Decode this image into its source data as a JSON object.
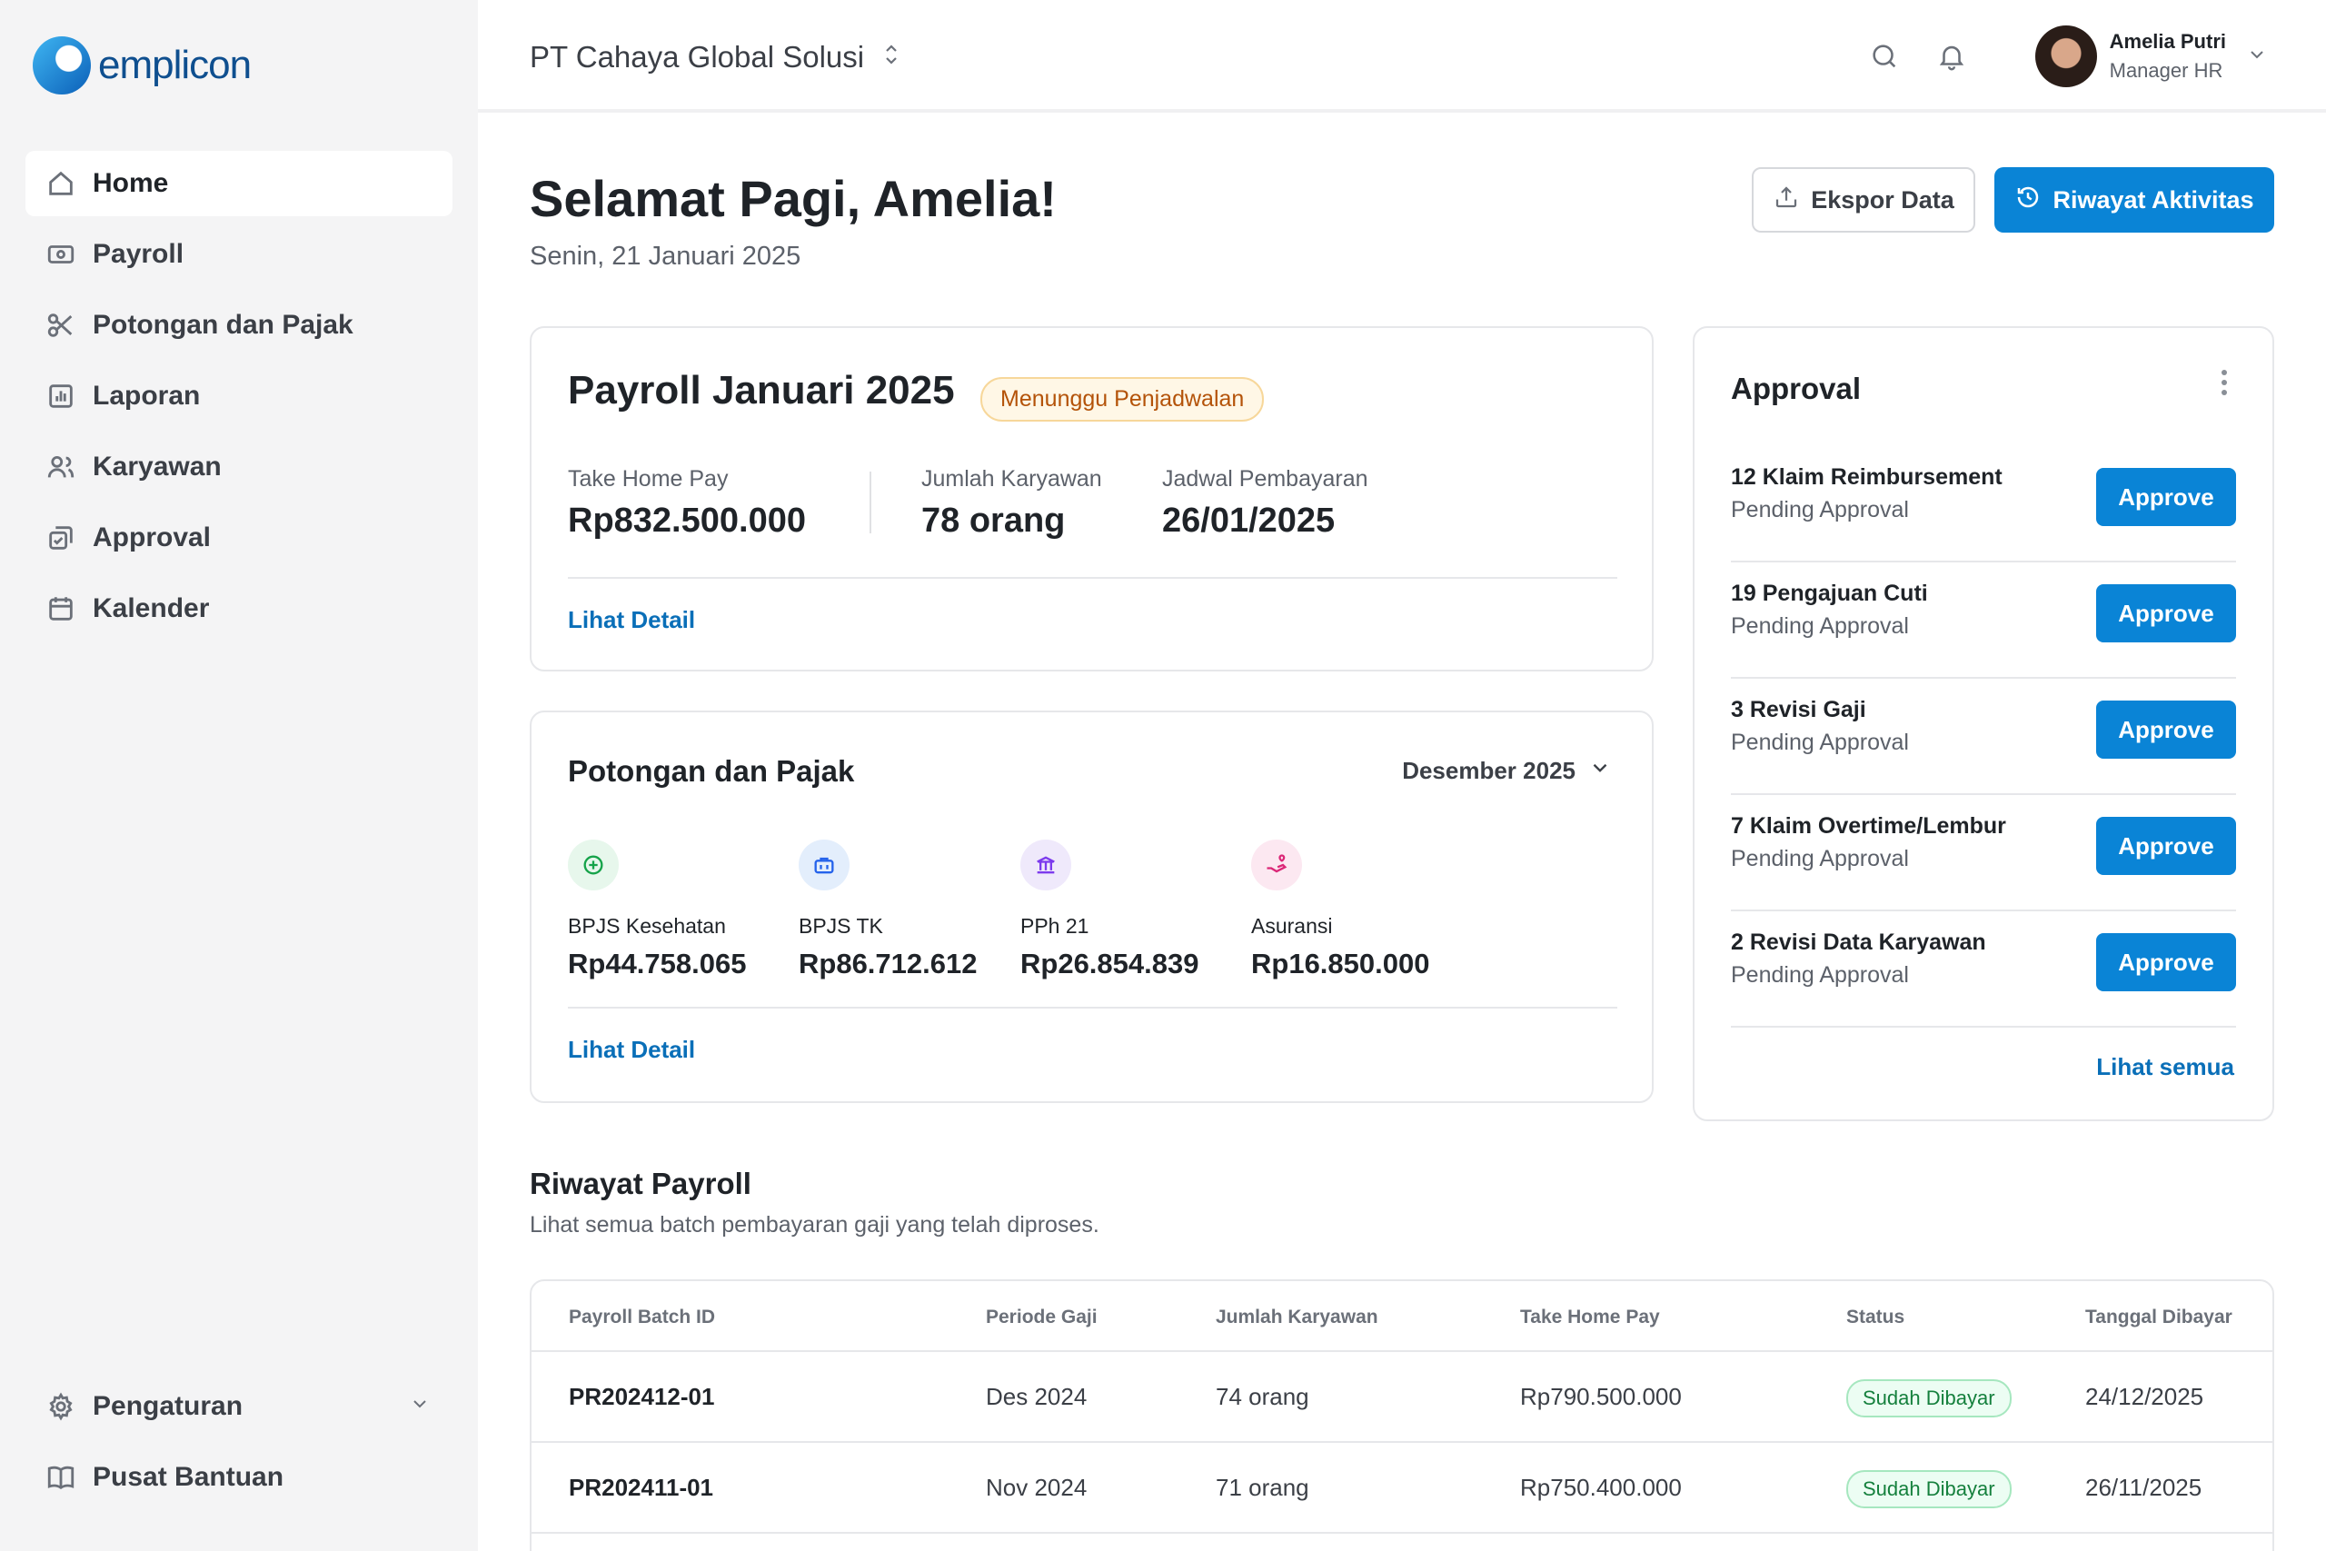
{
  "brand": {
    "name": "emplicon",
    "accent": "#0a84d6"
  },
  "sidebar": {
    "items": [
      {
        "label": "Home",
        "icon": "home-icon",
        "active": true
      },
      {
        "label": "Payroll",
        "icon": "money-icon"
      },
      {
        "label": "Potongan dan Pajak",
        "icon": "scissors-icon"
      },
      {
        "label": "Laporan",
        "icon": "chart-icon"
      },
      {
        "label": "Karyawan",
        "icon": "users-icon"
      },
      {
        "label": "Approval",
        "icon": "approval-icon"
      },
      {
        "label": "Kalender",
        "icon": "calendar-icon"
      }
    ],
    "bottom": [
      {
        "label": "Pengaturan",
        "icon": "gear-icon"
      },
      {
        "label": "Pusat Bantuan",
        "icon": "book-icon"
      }
    ]
  },
  "header": {
    "company": "PT Cahaya Global Solusi",
    "user": {
      "name": "Amelia Putri",
      "role": "Manager HR"
    }
  },
  "greeting": {
    "title": "Selamat Pagi, Amelia!",
    "date": "Senin, 21 Januari 2025",
    "export_label": "Ekspor Data",
    "history_label": "Riwayat Aktivitas"
  },
  "payroll_card": {
    "title": "Payroll Januari 2025",
    "status": "Menunggu Penjadwalan",
    "stats": [
      {
        "label": "Take Home Pay",
        "value": "Rp832.500.000"
      },
      {
        "label": "Jumlah Karyawan",
        "value": "78 orang"
      },
      {
        "label": "Jadwal Pembayaran",
        "value": "26/01/2025"
      }
    ],
    "link": "Lihat Detail"
  },
  "pajak_card": {
    "title": "Potongan dan Pajak",
    "period": "Desember 2025",
    "items": [
      {
        "label": "BPJS Kesehatan",
        "value": "Rp44.758.065",
        "icon": "health-icon",
        "color": "#16a34a",
        "bg": "#e7f7ec"
      },
      {
        "label": "BPJS TK",
        "value": "Rp86.712.612",
        "icon": "briefcase-icon",
        "color": "#2563eb",
        "bg": "#e3eefc"
      },
      {
        "label": "PPh 21",
        "value": "Rp26.854.839",
        "icon": "bank-icon",
        "color": "#7c3aed",
        "bg": "#efe9fb"
      },
      {
        "label": "Asuransi",
        "value": "Rp16.850.000",
        "icon": "insurance-icon",
        "color": "#db2777",
        "bg": "#fce8f1"
      }
    ],
    "link": "Lihat Detail"
  },
  "approval": {
    "title": "Approval",
    "items": [
      {
        "title": "12 Klaim Reimbursement",
        "sub": "Pending Approval",
        "action": "Approve"
      },
      {
        "title": "19 Pengajuan Cuti",
        "sub": "Pending Approval",
        "action": "Approve"
      },
      {
        "title": "3 Revisi Gaji",
        "sub": "Pending Approval",
        "action": "Approve"
      },
      {
        "title": "7 Klaim Overtime/Lembur",
        "sub": "Pending Approval",
        "action": "Approve"
      },
      {
        "title": "2 Revisi Data Karyawan",
        "sub": "Pending Approval",
        "action": "Approve"
      }
    ],
    "see_all": "Lihat semua"
  },
  "history": {
    "title": "Riwayat Payroll",
    "subtitle": "Lihat semua batch pembayaran gaji yang telah diproses.",
    "columns": [
      "Payroll Batch ID",
      "Periode Gaji",
      "Jumlah Karyawan",
      "Take Home Pay",
      "Status",
      "Tanggal Dibayar"
    ],
    "rows": [
      {
        "id": "PR202412-01",
        "period": "Des 2024",
        "count": "74 orang",
        "thp": "Rp790.500.000",
        "status": "Sudah Dibayar",
        "paid": "24/12/2025"
      },
      {
        "id": "PR202411-01",
        "period": "Nov 2024",
        "count": "71 orang",
        "thp": "Rp750.400.000",
        "status": "Sudah Dibayar",
        "paid": "26/11/2025"
      }
    ]
  }
}
